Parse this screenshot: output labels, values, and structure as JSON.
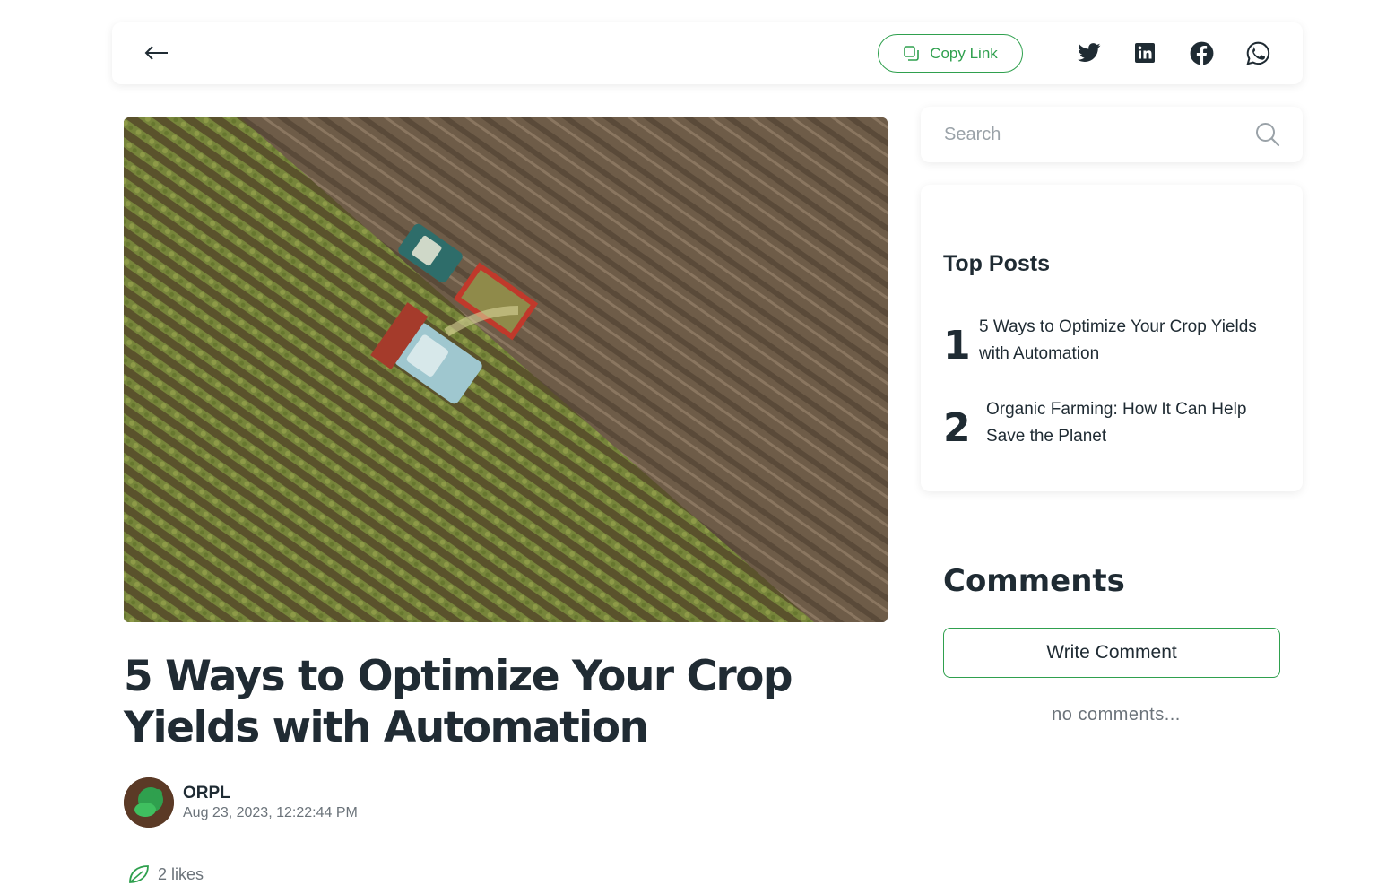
{
  "topbar": {
    "copy_link_label": "Copy Link",
    "icons": {
      "back": "arrow-left-icon",
      "copy": "copy-icon",
      "twitter": "twitter-icon",
      "linkedin": "linkedin-icon",
      "facebook": "facebook-icon",
      "whatsapp": "whatsapp-icon"
    }
  },
  "post": {
    "title": "5 Ways to Optimize Your Crop Yields with Automation",
    "author": "ORPL",
    "date": "Aug 23, 2023, 12:22:44 PM",
    "likes_label": "2 likes"
  },
  "search": {
    "placeholder": "Search",
    "value": ""
  },
  "top_posts": {
    "heading": "Top Posts",
    "items": [
      {
        "rank": "1",
        "title": "5 Ways to Optimize Your Crop Yields with Automation"
      },
      {
        "rank": "2",
        "title": "Organic Farming: How It Can Help Save the Planet"
      }
    ]
  },
  "comments": {
    "heading": "Comments",
    "write_label": "Write Comment",
    "empty_text": "no comments..."
  },
  "colors": {
    "accent": "#2fa04e",
    "text": "#1f2b33",
    "muted": "#6b737a"
  }
}
